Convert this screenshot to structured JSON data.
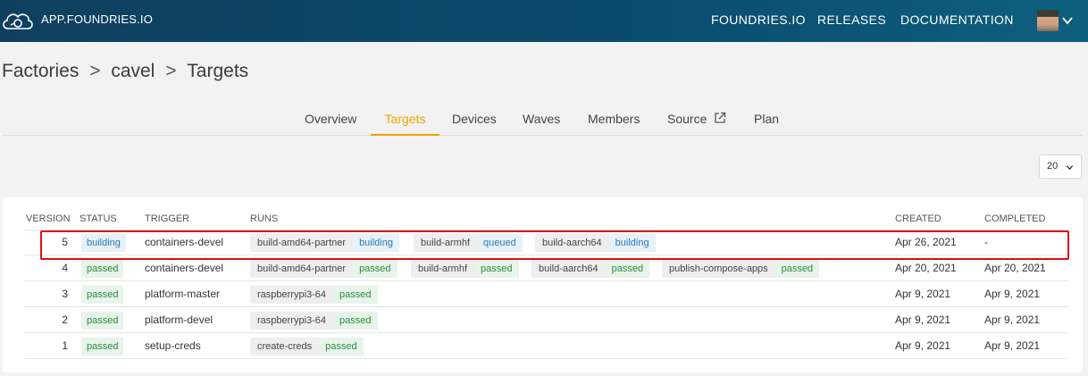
{
  "topbar": {
    "brand": "APP.FOUNDRIES.IO",
    "links": [
      "FOUNDRIES.IO",
      "RELEASES",
      "DOCUMENTATION"
    ],
    "logo_icon": "cloud-icon",
    "avatar_icon": "user-avatar"
  },
  "breadcrumb": {
    "items": [
      "Factories",
      "cavel",
      "Targets"
    ],
    "separator": ">"
  },
  "tabs": [
    "Overview",
    "Targets",
    "Devices",
    "Waves",
    "Members",
    "Source",
    "Plan"
  ],
  "active_tab": "Targets",
  "page_size": {
    "value": "20"
  },
  "table": {
    "headers": [
      "VERSION",
      "STATUS",
      "TRIGGER",
      "RUNS",
      "CREATED",
      "COMPLETED"
    ],
    "rows": [
      {
        "version": "5",
        "status": "building",
        "trigger": "containers-devel",
        "runs": [
          {
            "name": "build-amd64-partner",
            "status": "building"
          },
          {
            "name": "build-armhf",
            "status": "queued"
          },
          {
            "name": "build-aarch64",
            "status": "building"
          }
        ],
        "created": "Apr 26, 2021",
        "completed": "-"
      },
      {
        "version": "4",
        "status": "passed",
        "trigger": "containers-devel",
        "runs": [
          {
            "name": "build-amd64-partner",
            "status": "passed"
          },
          {
            "name": "build-armhf",
            "status": "passed"
          },
          {
            "name": "build-aarch64",
            "status": "passed"
          },
          {
            "name": "publish-compose-apps",
            "status": "passed"
          }
        ],
        "created": "Apr 20, 2021",
        "completed": "Apr 20, 2021"
      },
      {
        "version": "3",
        "status": "passed",
        "trigger": "platform-master",
        "runs": [
          {
            "name": "raspberrypi3-64",
            "status": "passed"
          }
        ],
        "created": "Apr 9, 2021",
        "completed": "Apr 9, 2021"
      },
      {
        "version": "2",
        "status": "passed",
        "trigger": "platform-devel",
        "runs": [
          {
            "name": "raspberrypi3-64",
            "status": "passed"
          }
        ],
        "created": "Apr 9, 2021",
        "completed": "Apr 9, 2021"
      },
      {
        "version": "1",
        "status": "passed",
        "trigger": "setup-creds",
        "runs": [
          {
            "name": "create-creds",
            "status": "passed"
          }
        ],
        "created": "Apr 9, 2021",
        "completed": "Apr 9, 2021"
      }
    ]
  },
  "colors": {
    "accent": "#f0a500",
    "topbar": "#0a4a6c",
    "building": "#2a7ab4",
    "passed": "#2e8b3e",
    "highlight": "#e01010"
  }
}
